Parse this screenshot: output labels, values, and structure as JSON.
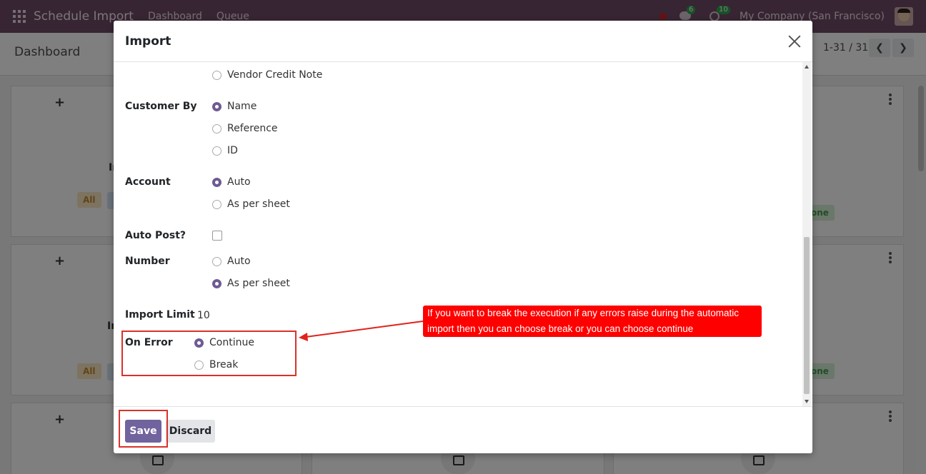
{
  "navbar": {
    "app_title": "Schedule Import",
    "menu": [
      "Dashboard",
      "Queue"
    ],
    "chat_count": "6",
    "activity_count": "10",
    "company": "My Company (San Francisco)"
  },
  "control_panel": {
    "title": "Dashboard",
    "pager": "1-31 / 31"
  },
  "background_cards": {
    "all_chip": "All",
    "done_chip": "one",
    "partial_text": "In"
  },
  "modal": {
    "title": "Import",
    "fields": {
      "move_type_last_option": "Vendor Credit Note",
      "customer_by": {
        "label": "Customer By",
        "options": [
          "Name",
          "Reference",
          "ID"
        ],
        "selected": "Name"
      },
      "account": {
        "label": "Account",
        "options": [
          "Auto",
          "As per sheet"
        ],
        "selected": "Auto"
      },
      "auto_post": {
        "label": "Auto Post?",
        "checked": false
      },
      "number": {
        "label": "Number",
        "options": [
          "Auto",
          "As per sheet"
        ],
        "selected": "As per sheet"
      },
      "import_limit": {
        "label": "Import Limit",
        "value": "10"
      },
      "on_error": {
        "label": "On Error",
        "options": [
          "Continue",
          "Break"
        ],
        "selected": "Continue"
      }
    },
    "buttons": {
      "save": "Save",
      "discard": "Discard"
    }
  },
  "annotation": {
    "callout_line1": "If you want to break the execution if any errors raise during the automatic",
    "callout_line2": "import then you can choose break or you can choose continue",
    "color": "#ff0000"
  },
  "colors": {
    "navbar": "#714b67",
    "primary": "#71639e"
  }
}
